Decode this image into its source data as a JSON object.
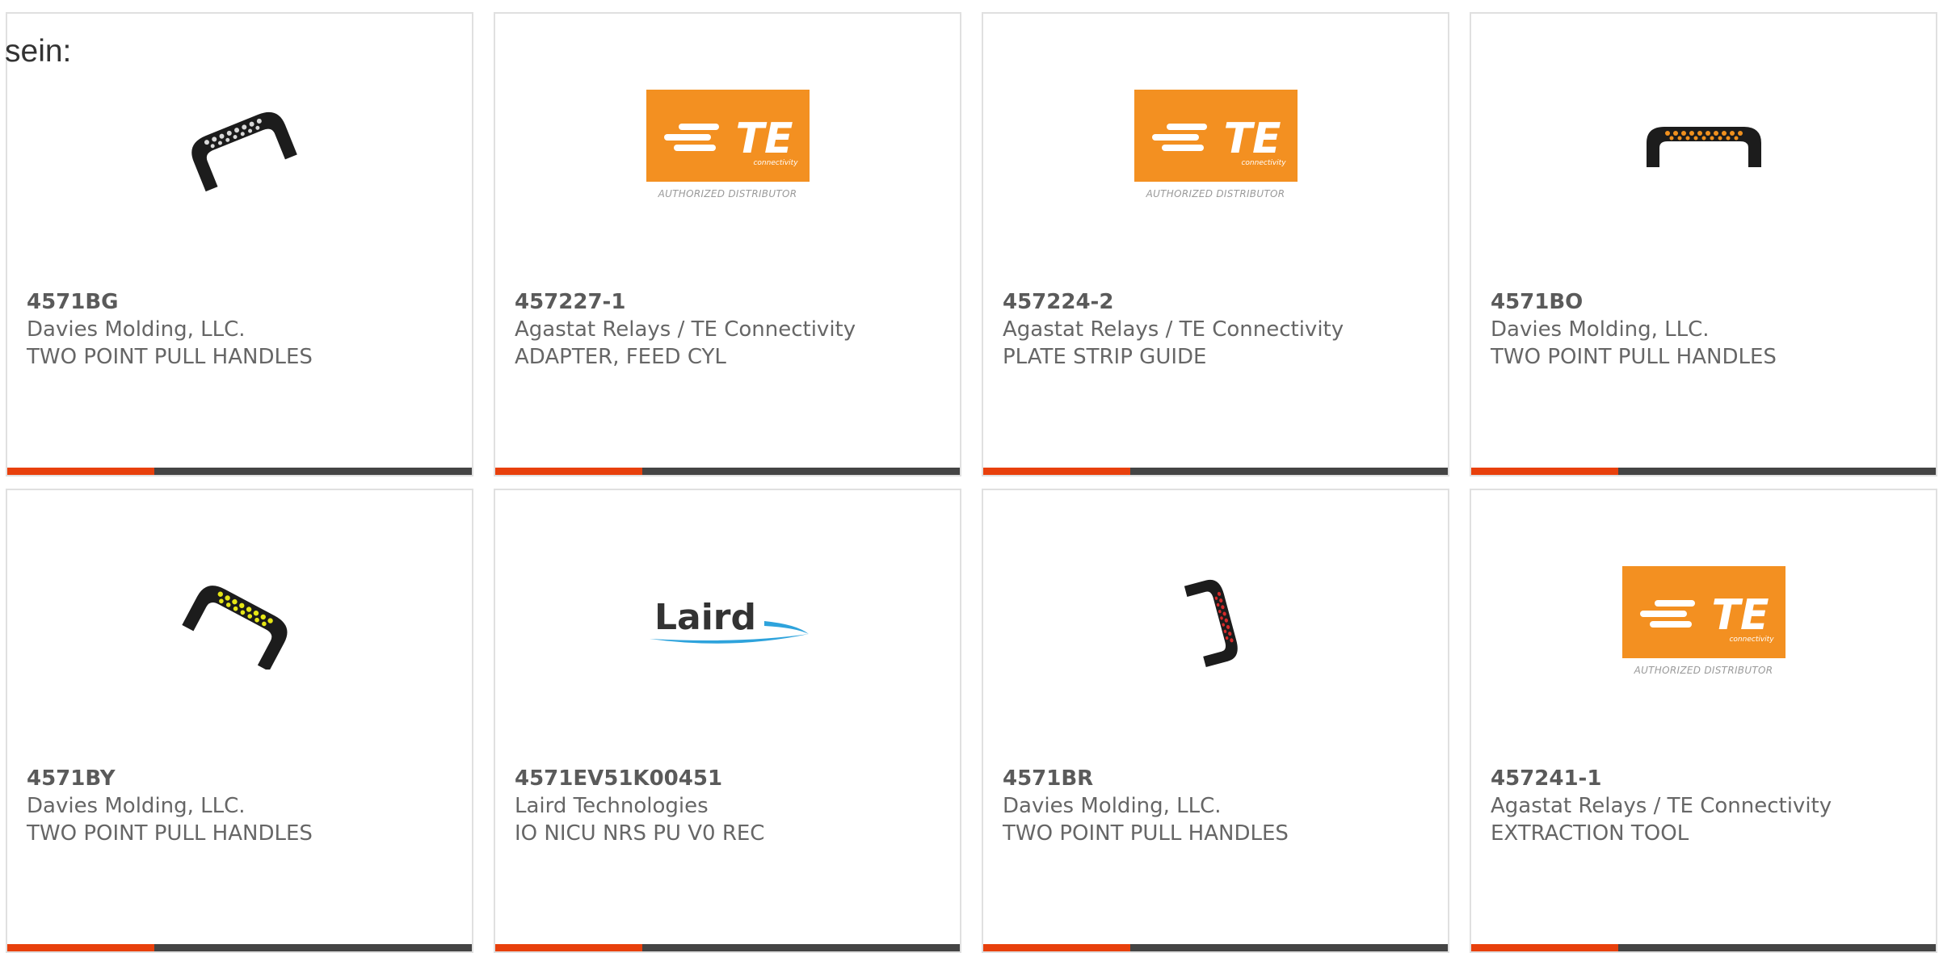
{
  "page_label": "sein:",
  "colors": {
    "accent": "#e8400c",
    "bar": "#444444",
    "te_orange": "#f39021",
    "laird_blue": "#2ea3dc"
  },
  "logos": {
    "te_wordmark": "TE",
    "te_subtitle": "connectivity",
    "te_distributor": "AUTHORIZED DISTRIBUTOR",
    "laird_wordmark": "Laird"
  },
  "products": [
    {
      "part_number": "4571BG",
      "manufacturer": "Davies Molding, LLC.",
      "description": "TWO POINT PULL HANDLES",
      "image": "handle-icon",
      "handle_color": "#d9d9d9"
    },
    {
      "part_number": "457227-1",
      "manufacturer": "Agastat Relays / TE Connectivity",
      "description": "ADAPTER, FEED CYL",
      "image": "te-logo-icon"
    },
    {
      "part_number": "457224-2",
      "manufacturer": "Agastat Relays / TE Connectivity",
      "description": "PLATE STRIP GUIDE",
      "image": "te-logo-icon"
    },
    {
      "part_number": "4571BO",
      "manufacturer": "Davies Molding, LLC.",
      "description": "TWO POINT PULL HANDLES",
      "image": "handle-icon",
      "handle_color": "#f0901e"
    },
    {
      "part_number": "4571BY",
      "manufacturer": "Davies Molding, LLC.",
      "description": "TWO POINT PULL HANDLES",
      "image": "handle-icon",
      "handle_color": "#e6e615"
    },
    {
      "part_number": "4571EV51K00451",
      "manufacturer": "Laird Technologies",
      "description": "IO NICU NRS PU V0 REC",
      "image": "laird-logo-icon"
    },
    {
      "part_number": "4571BR",
      "manufacturer": "Davies Molding, LLC.",
      "description": "TWO POINT PULL HANDLES",
      "image": "handle-icon",
      "handle_color": "#d42a2a"
    },
    {
      "part_number": "457241-1",
      "manufacturer": "Agastat Relays / TE Connectivity",
      "description": "EXTRACTION TOOL",
      "image": "te-logo-icon"
    }
  ]
}
